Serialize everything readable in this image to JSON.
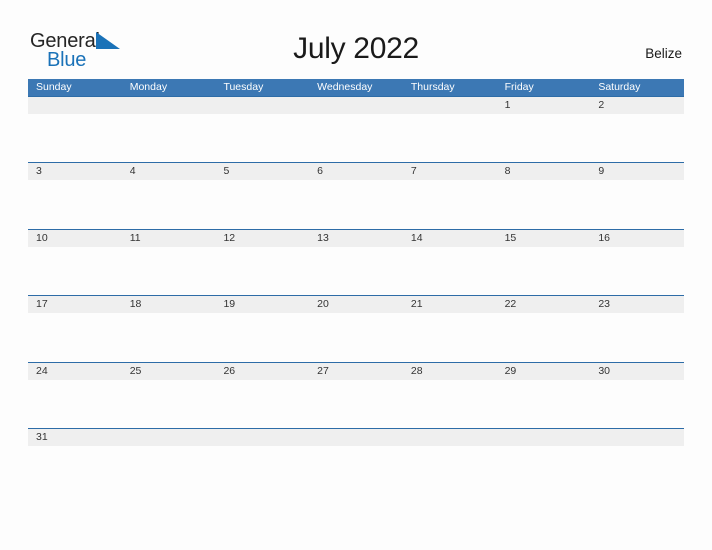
{
  "brand": {
    "name_part1": "General",
    "name_part2": "Blue",
    "flag_icon": "blue-triangle-flag-icon",
    "primary_color": "#1a72b8",
    "text_color": "#252525"
  },
  "header": {
    "title": "July 2022",
    "region": "Belize"
  },
  "calendar": {
    "month": "July",
    "year": "2022",
    "header_bg_color": "#3c78b4",
    "row_border_color": "#2d6ca7",
    "date_band_color": "#efefef",
    "weekdays": [
      "Sunday",
      "Monday",
      "Tuesday",
      "Wednesday",
      "Thursday",
      "Friday",
      "Saturday"
    ],
    "weeks": [
      [
        "",
        "",
        "",
        "",
        "",
        "1",
        "2"
      ],
      [
        "3",
        "4",
        "5",
        "6",
        "7",
        "8",
        "9"
      ],
      [
        "10",
        "11",
        "12",
        "13",
        "14",
        "15",
        "16"
      ],
      [
        "17",
        "18",
        "19",
        "20",
        "21",
        "22",
        "23"
      ],
      [
        "24",
        "25",
        "26",
        "27",
        "28",
        "29",
        "30"
      ],
      [
        "31",
        "",
        "",
        "",
        "",
        "",
        ""
      ]
    ]
  }
}
